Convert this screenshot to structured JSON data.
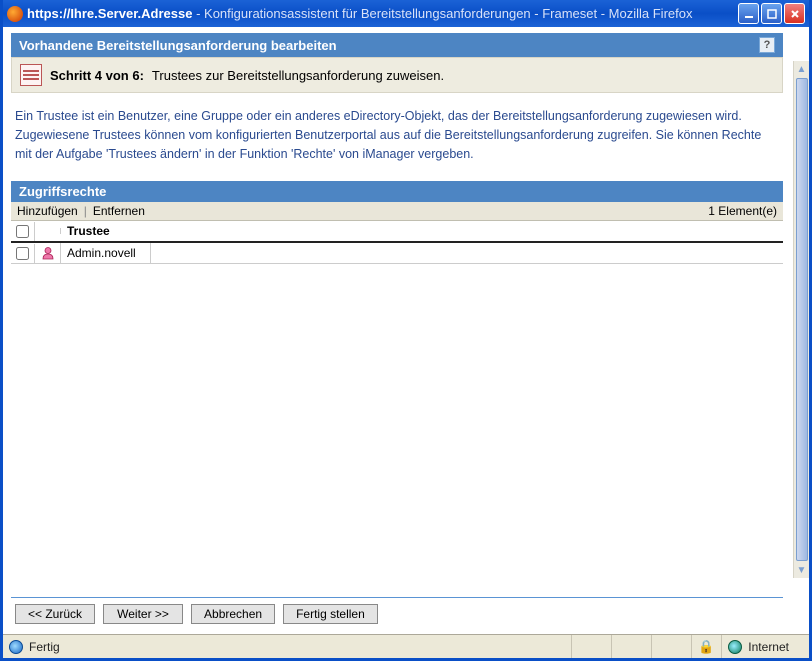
{
  "window": {
    "url_prefix": "https://Ihre.Server.Adresse",
    "title_rest": " - Konfigurationsassistent für Bereitstellungsanforderungen - Frameset - Mozilla Firefox"
  },
  "panel": {
    "title": "Vorhandene Bereitstellungsanforderung bearbeiten",
    "help": "?"
  },
  "step": {
    "label": "Schritt 4 von 6:",
    "desc": "Trustees zur Bereitstellungsanforderung zuweisen."
  },
  "description": "Ein Trustee ist ein Benutzer, eine Gruppe oder ein anderes eDirectory-Objekt, das der Bereitstellungsanforderung zugewiesen wird. Zugewiesene Trustees können vom konfigurierten Benutzerportal aus auf die Bereitstellungsanforderung zugreifen. Sie können Rechte mit der Aufgabe 'Trustees ändern' in der Funktion 'Rechte' von iManager vergeben.",
  "section": {
    "title": "Zugriffsrechte"
  },
  "toolbar": {
    "add": "Hinzufügen",
    "remove": "Entfernen",
    "count": "1 Element(e)"
  },
  "table": {
    "header_trustee": "Trustee",
    "rows": [
      {
        "name": "Admin.novell"
      }
    ]
  },
  "buttons": {
    "back": "<< Zurück",
    "next": "Weiter >>",
    "cancel": "Abbrechen",
    "finish": "Fertig stellen"
  },
  "status": {
    "ready": "Fertig",
    "zone": "Internet"
  }
}
